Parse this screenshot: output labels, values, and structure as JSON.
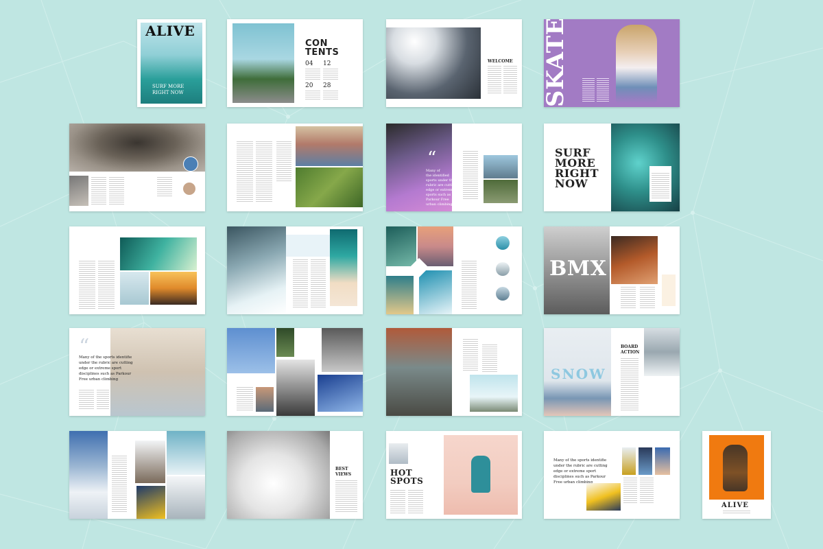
{
  "cover": {
    "title": "ALIVE",
    "headline_line1": "SURF MORE",
    "headline_line2": "RIGHT NOW"
  },
  "contents": {
    "title_line1": "CON",
    "title_line2": "TENTS",
    "items": [
      "04",
      "12",
      "20",
      "28"
    ]
  },
  "welcome": {
    "title": "WELCOME"
  },
  "skate": {
    "title": "SKATE"
  },
  "surf_spread": {
    "line1": "SURF",
    "line2": "MORE",
    "line3": "RIGHT",
    "line4": "NOW"
  },
  "quote_purple": {
    "mark": "“",
    "lines": [
      "Many of",
      "the identified",
      "sports under the",
      "rubric are cutting",
      "edge or extreme",
      "sports such as",
      "Parkour Free",
      "urban climbing"
    ]
  },
  "bmx": {
    "title": "BMX"
  },
  "quote_bike": {
    "mark": "“",
    "lines": [
      "Many of the sports identifie",
      "under the rubric are cutting",
      "edge or extreme sport",
      "disciplines such as Parkour",
      "Free urban climbing"
    ]
  },
  "snow": {
    "title": "SNOW",
    "side_line1": "BOARD",
    "side_line2": "ACTION"
  },
  "best_views": {
    "line1": "BEST",
    "line2": "VIEWS"
  },
  "hot_spots": {
    "line1": "HOT",
    "line2": "SPOTS"
  },
  "quote_snow": {
    "lines": [
      "Many of the sports identifie",
      "under the rubric are cutting",
      "edge or extreme sport",
      "disciplines such as Parkour",
      "Free urban climbing"
    ]
  },
  "back_cover": {
    "title": "ALIVE"
  },
  "colors": {
    "background": "#bfe6e2",
    "skate_purple": "#a27bc4",
    "bmx_orange": "#f07a10",
    "surf_teal": "#2e8f8a"
  }
}
